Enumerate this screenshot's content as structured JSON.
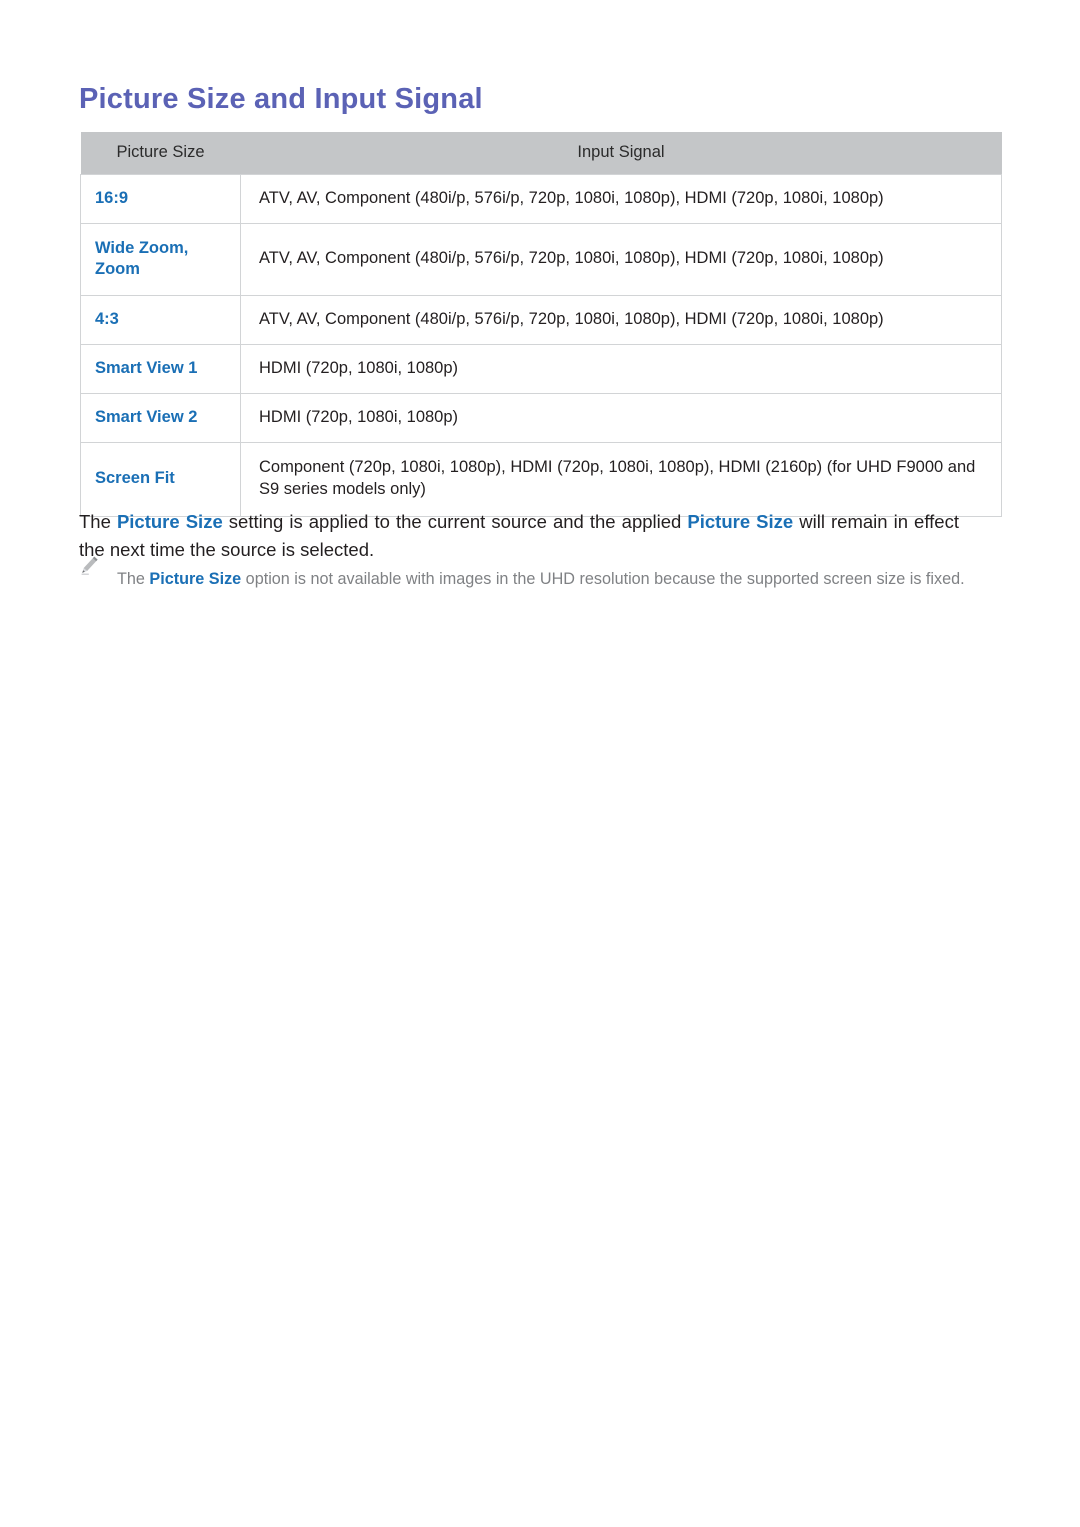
{
  "document": {
    "title": "Picture Size and Input Signal"
  },
  "table": {
    "headers": {
      "picture_size": "Picture Size",
      "input_signal": "Input Signal"
    },
    "rows": [
      {
        "size": "16:9",
        "size_line2": "",
        "signal": "ATV, AV, Component (480i/p, 576i/p, 720p, 1080i, 1080p), HDMI (720p, 1080i, 1080p)"
      },
      {
        "size": "Wide Zoom,",
        "size_line2": "Zoom",
        "signal": "ATV, AV, Component (480i/p, 576i/p, 720p, 1080i, 1080p), HDMI (720p, 1080i, 1080p)"
      },
      {
        "size": "4:3",
        "size_line2": "",
        "signal": "ATV, AV, Component (480i/p, 576i/p, 720p, 1080i, 1080p), HDMI (720p, 1080i, 1080p)"
      },
      {
        "size": "Smart View 1",
        "size_line2": "",
        "signal": "HDMI (720p, 1080i, 1080p)"
      },
      {
        "size": "Smart View 2",
        "size_line2": "",
        "signal": "HDMI (720p, 1080i, 1080p)"
      },
      {
        "size": "Screen Fit",
        "size_line2": "",
        "signal": "Component (720p, 1080i, 1080p), HDMI (720p, 1080i, 1080p), HDMI (2160p) (for UHD F9000 and S9 series models only)"
      }
    ]
  },
  "paragraph": {
    "part1": "The ",
    "highlight1": "Picture Size",
    "part2": " setting is applied to the current source and the applied ",
    "highlight2": "Picture Size",
    "part3": " will remain in effect the next time the source is selected."
  },
  "note": {
    "icon": "pencil-icon",
    "part1": "The ",
    "highlight": "Picture Size",
    "part2": " option is not available with images in the UHD resolution because the supported screen size is fixed."
  },
  "colors": {
    "title": "#5b62b5",
    "link": "#1a6fb5",
    "header_bg": "#c4c6c8",
    "body_text": "#231f20",
    "note_text": "#7f8184",
    "border": "#d2d4d6"
  }
}
